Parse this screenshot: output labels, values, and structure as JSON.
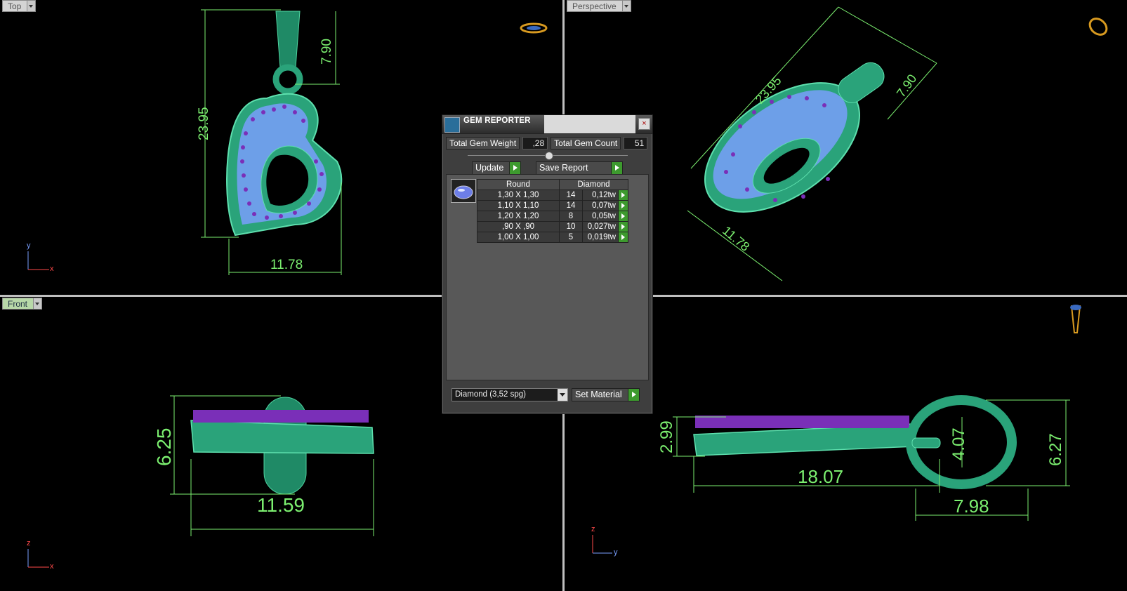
{
  "viewports": {
    "top": {
      "label": "Top",
      "dims": {
        "height": "23.95",
        "bail": "7.90",
        "width": "11.78"
      },
      "axis": {
        "v": "y",
        "h": "x"
      }
    },
    "perspective": {
      "label": "Perspective",
      "dims": {
        "height": "23.95",
        "bail": "7.90",
        "width": "11.78"
      }
    },
    "front": {
      "label": "Front",
      "dims": {
        "height": "6.25",
        "width": "11.59"
      },
      "axis": {
        "v": "z",
        "h": "x"
      }
    },
    "right": {
      "dims": {
        "height": "2.99",
        "length": "18.07",
        "loop_inner": "4.07",
        "loop_height": "6.27",
        "loop_width": "7.98"
      },
      "axis": {
        "v": "z",
        "h": "y"
      }
    }
  },
  "dialog": {
    "title": "GEM REPORTER",
    "close": "×",
    "total_weight_label": "Total Gem Weight",
    "total_weight_value": ",28",
    "total_count_label": "Total Gem Count",
    "total_count_value": "51",
    "update_label": "Update",
    "save_report_label": "Save Report",
    "table": {
      "headers": [
        "Round",
        "",
        "Diamond"
      ],
      "rows": [
        {
          "size": "1,30 X 1,30",
          "count": "14",
          "weight": "0,12tw"
        },
        {
          "size": "1,10 X 1,10",
          "count": "14",
          "weight": "0,07tw"
        },
        {
          "size": "1,20 X 1,20",
          "count": "8",
          "weight": "0,05tw"
        },
        {
          "size": ",90 X ,90",
          "count": "10",
          "weight": "0,027tw"
        },
        {
          "size": "1,00 X 1,00",
          "count": "5",
          "weight": "0,019tw"
        }
      ]
    },
    "material_select": "Diamond     (3,52 spg)",
    "set_material_label": "Set Material"
  },
  "colors": {
    "dim_line": "#7cf070",
    "metal": "#2aa37a",
    "gem_light": "#8fb8f8",
    "gem_purple": "#7a2fb8"
  }
}
